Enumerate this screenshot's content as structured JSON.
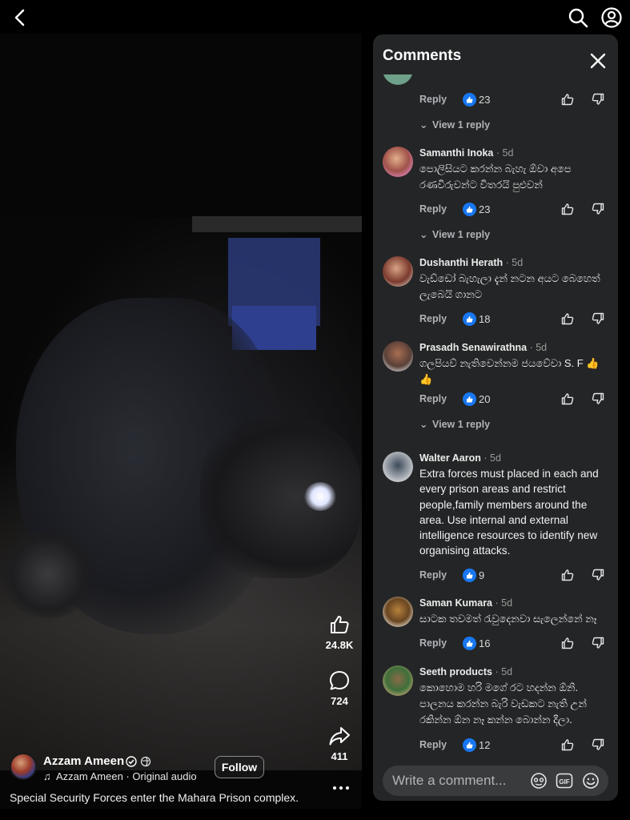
{
  "video": {
    "author": "Azzam Ameen",
    "audio": "Azzam Ameen · Original audio",
    "follow_label": "Follow",
    "caption": "Special Security Forces enter the Mahara Prison complex.",
    "likes": "24.8K",
    "comments": "724",
    "shares": "411"
  },
  "panel": {
    "title": "Comments",
    "composer_placeholder": "Write a comment..."
  },
  "comments": [
    {
      "name": "",
      "time": "",
      "text": "",
      "likes": "23",
      "replies": "View 1 reply"
    },
    {
      "name": "Samanthi Inoka",
      "time": "· 5d",
      "text": "පොලිසියට කරන්න බැහැ ඕවා අපෙ රණවිරුවන්ට විතරයි පුළුවන්",
      "likes": "23",
      "replies": "View 1 reply"
    },
    {
      "name": "Dushanthi Herath",
      "time": "· 5d",
      "text": "වැඩ්ඩෝ බැහැලා දැන් නටන අයට බෙහෙත් ලැබෙයි ගානට",
      "likes": "18",
      "replies": ""
    },
    {
      "name": "Prasadh Senawirathna",
      "time": "· 5d",
      "text": "ගලපියව් නැතිවෙන්නම ජයවේවා S. F 👍 👍",
      "likes": "20",
      "replies": "View 1 reply"
    },
    {
      "name": "Walter Aaron",
      "time": "· 5d",
      "text": "Extra forces must placed in each and every prison areas and restrict people,family members around the area.  Use internal and external intelligence resources to identify new organising attacks.",
      "likes": "9",
      "replies": ""
    },
    {
      "name": "Saman Kumara",
      "time": "· 5d",
      "text": "සාටක තවමත් රැවුදෙනවා සැලෙන්නේ නෑ",
      "likes": "16",
      "replies": ""
    },
    {
      "name": "Seeth products",
      "time": "· 5d",
      "text": "කොහොම හරි මගේ රට හදන්න ඕනි. පාලනය කරන්න බැරි වැඩකට නැති උන් රකින්න ඕන නෑ කන්න බොන්න දීලා.",
      "likes": "12",
      "replies": ""
    }
  ],
  "labels": {
    "reply": "Reply"
  },
  "icons": [
    "back-icon",
    "search-icon",
    "profile-icon",
    "like-icon",
    "comment-icon",
    "share-icon",
    "verified-icon",
    "globe-icon",
    "music-icon",
    "more-icon",
    "close-icon",
    "thumb-up-icon",
    "thumb-down-icon",
    "chevron-down-icon",
    "sticker-icon",
    "gif-icon",
    "emoji-icon"
  ]
}
